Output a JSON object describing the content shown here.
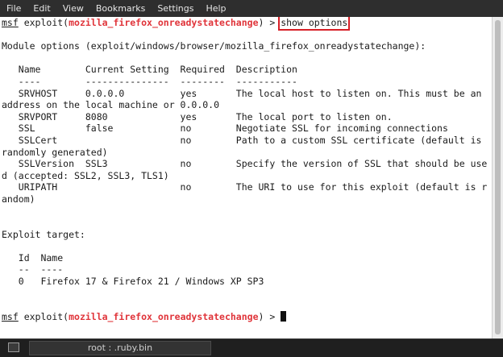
{
  "menubar": {
    "items": [
      "File",
      "Edit",
      "View",
      "Bookmarks",
      "Settings",
      "Help"
    ]
  },
  "terminal": {
    "prompt_prefix": "msf",
    "prompt_exploit_open": " exploit(",
    "module": "mozilla_firefox_onreadystatechange",
    "prompt_close": ") > ",
    "command": "show options",
    "lines": [
      "",
      "Module options (exploit/windows/browser/mozilla_firefox_onreadystatechange):",
      "",
      "   Name        Current Setting  Required  Description",
      "   ----        ---------------  --------  -----------",
      "   SRVHOST     0.0.0.0          yes       The local host to listen on. This must be an",
      "address on the local machine or 0.0.0.0",
      "   SRVPORT     8080             yes       The local port to listen on.",
      "   SSL         false            no        Negotiate SSL for incoming connections",
      "   SSLCert                      no        Path to a custom SSL certificate (default is",
      "randomly generated)",
      "   SSLVersion  SSL3             no        Specify the version of SSL that should be use",
      "d (accepted: SSL2, SSL3, TLS1)",
      "   URIPATH                      no        The URI to use for this exploit (default is r",
      "andom)",
      "",
      "",
      "Exploit target:",
      "",
      "   Id  Name",
      "   --  ----",
      "   0   Firefox 17 & Firefox 21 / Windows XP SP3",
      "",
      ""
    ]
  },
  "taskbar": {
    "task_label": "root : .ruby.bin"
  },
  "colors": {
    "module_name": "#e0343a",
    "highlight_box": "#d71f26",
    "menubar_bg": "#2e2e2e",
    "terminal_bg": "#ffffff"
  },
  "icons": {
    "show_desktop": "show-desktop-icon"
  }
}
